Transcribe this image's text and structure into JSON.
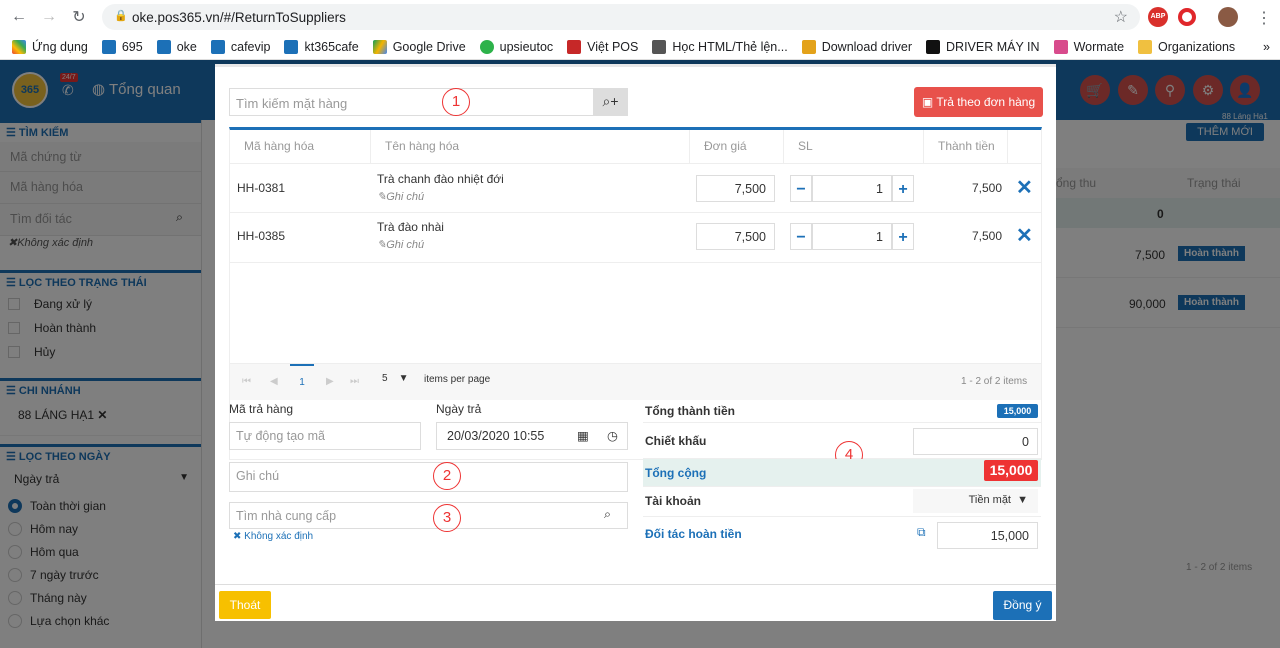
{
  "browser": {
    "url": "oke.pos365.vn/#/ReturnToSuppliers"
  },
  "bookmarks": [
    "Ứng dụng",
    "695",
    "oke",
    "cafevip",
    "kt365cafe",
    "Google Drive",
    "upsieutoc",
    "Việt POS",
    "Học HTML/Thẻ lện...",
    "Download driver",
    "DRIVER MÁY IN",
    "Wormate",
    "Organizations"
  ],
  "app": {
    "logo": "365",
    "badge": "24/7",
    "menu": "Tổng quan",
    "location": "88 Láng Hạ1",
    "new_button": "THÊM MỚI"
  },
  "sidebar": {
    "search_title": "TÌM KIẾM",
    "code_ph": "Mã chứng từ",
    "item_ph": "Mã hàng hóa",
    "partner_ph": "Tìm đối tác",
    "undefined": "Không xác định",
    "status_title": "LỌC THEO TRẠNG THÁI",
    "status": [
      "Đang xử lý",
      "Hoàn thành",
      "Hủy"
    ],
    "branch_title": "CHI NHÁNH",
    "branch": "88 LÁNG HẠ1",
    "date_title": "LỌC THEO NGÀY",
    "date_select": "Ngày trả",
    "date_options": [
      "Toàn thời gian",
      "Hôm nay",
      "Hôm qua",
      "7 ngày trước",
      "Tháng này",
      "Lựa chọn khác"
    ]
  },
  "background": {
    "col1": "ổng thu",
    "col2": "Trạng thái",
    "total": "0",
    "rows": [
      {
        "value": "7,500",
        "status": "Hoàn thành"
      },
      {
        "value": "90,000",
        "status": "Hoàn thành"
      }
    ],
    "footer": "1 - 2 of 2 items"
  },
  "modal": {
    "search_ph": "Tìm kiếm mặt hàng",
    "return_by_order": "Trả theo đơn hàng",
    "headers": [
      "Mã hàng hóa",
      "Tên hàng hóa",
      "Đơn giá",
      "SL",
      "Thành tiền"
    ],
    "rows": [
      {
        "code": "HH-0381",
        "name": "Trà chanh đào nhiệt đới",
        "note": "Ghi chú",
        "price": "7,500",
        "qty": "1",
        "total": "7,500"
      },
      {
        "code": "HH-0385",
        "name": "Trà đào nhài",
        "note": "Ghi chú",
        "price": "7,500",
        "qty": "1",
        "total": "7,500"
      }
    ],
    "pager": {
      "page": "1",
      "size": "5",
      "per_page": "items per page",
      "info": "1 - 2 of 2 items"
    },
    "return_code_lbl": "Mã trả hàng",
    "return_code_ph": "Tự động tạo mã",
    "date_lbl": "Ngày trả",
    "date_value": "20/03/2020 10:55",
    "note_ph": "Ghi chú",
    "supplier_ph": "Tìm nhà cung cấp",
    "supplier_undefined": "Không xác định",
    "subtotal_lbl": "Tổng thành tiền",
    "subtotal": "15,000",
    "discount_lbl": "Chiết khấu",
    "discount": "0",
    "total_lbl": "Tổng cộng",
    "total": "15,000",
    "account_lbl": "Tài khoản",
    "account": "Tiền mặt",
    "refund_lbl": "Đối tác hoàn tiền",
    "refund": "15,000",
    "exit": "Thoát",
    "ok": "Đồng ý",
    "markers": [
      "1",
      "2",
      "3",
      "4"
    ]
  }
}
